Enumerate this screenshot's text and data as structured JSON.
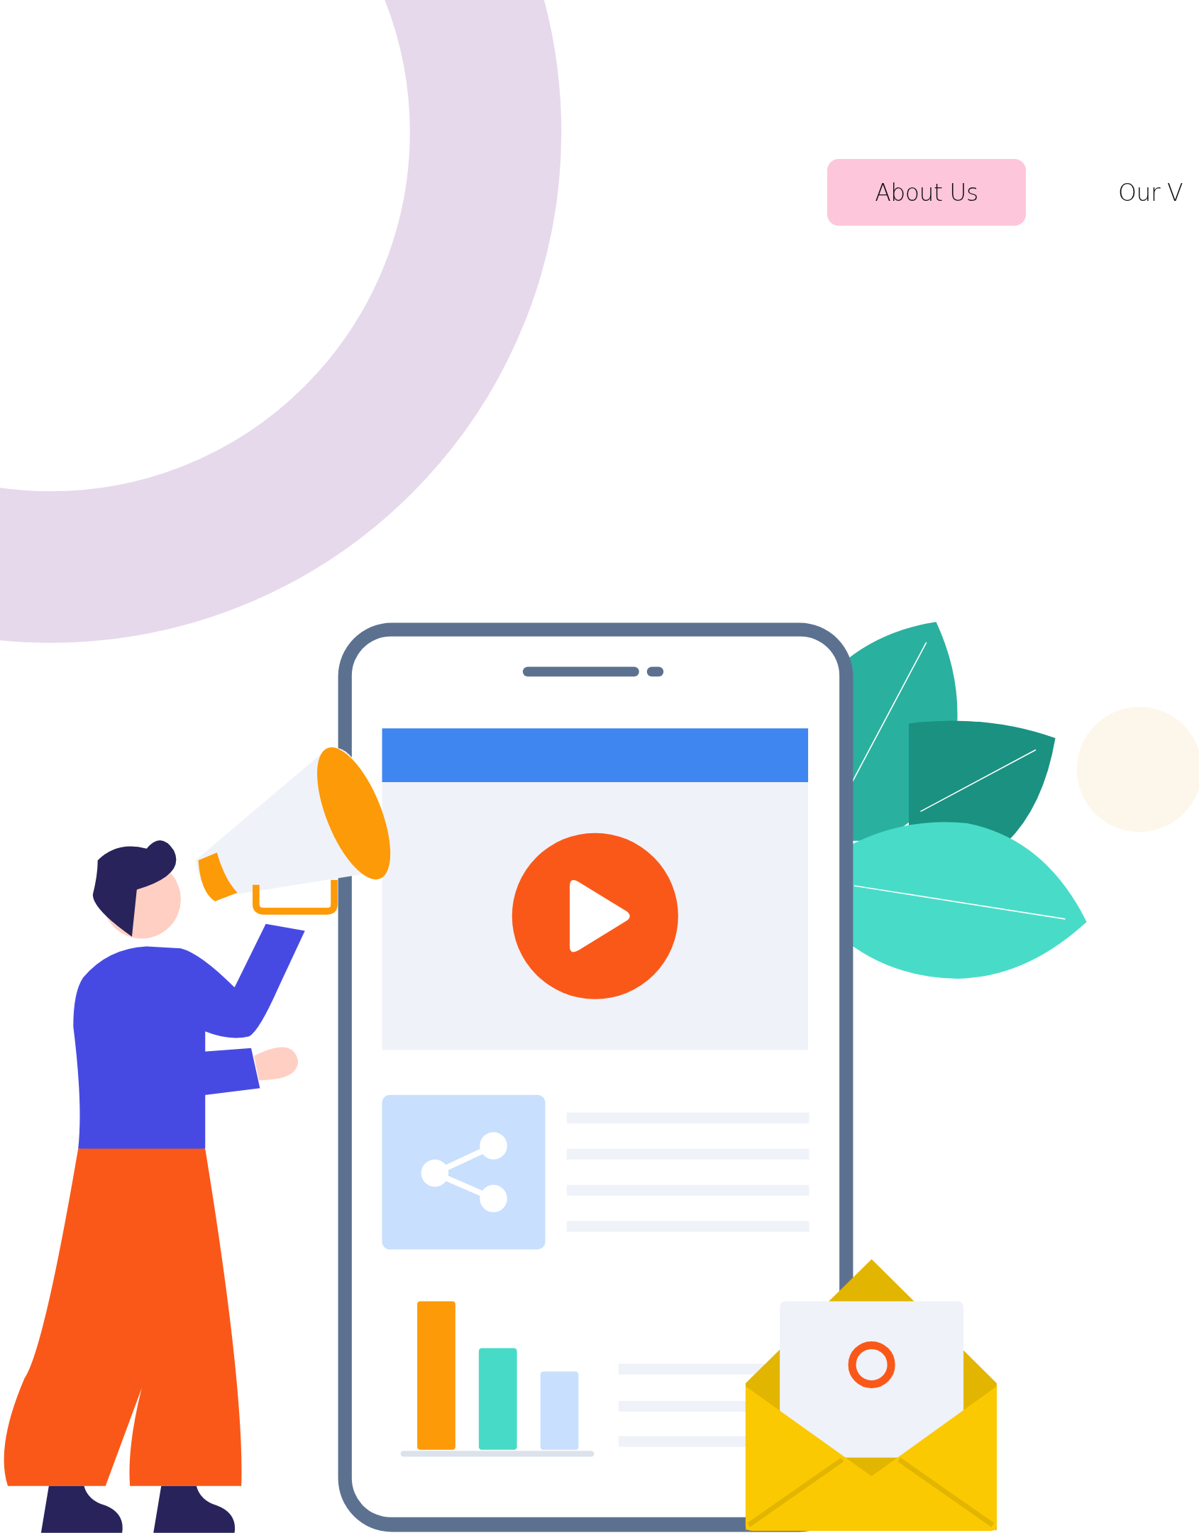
{
  "nav": {
    "items": [
      {
        "label": "About Us",
        "selected": true
      },
      {
        "label": "Our V",
        "selected": false
      }
    ]
  }
}
